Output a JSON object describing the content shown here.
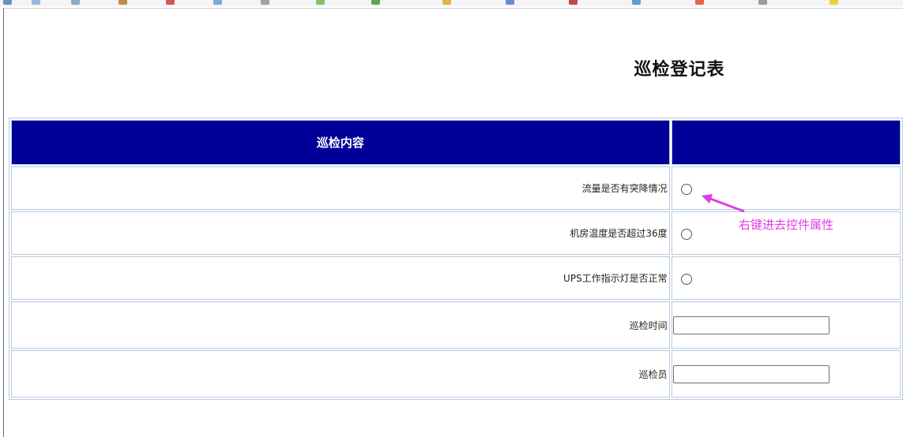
{
  "page": {
    "title": "巡检登记表"
  },
  "table": {
    "header": {
      "col1": "巡检内容",
      "col2": ""
    },
    "rows": [
      {
        "label": "流量是否有突降情况",
        "control": "radio"
      },
      {
        "label": "机房温度是否超过36度",
        "control": "radio"
      },
      {
        "label": "UPS工作指示灯是否正常",
        "control": "radio"
      },
      {
        "label": "巡检时间",
        "control": "text",
        "value": ""
      },
      {
        "label": "巡检员",
        "control": "text",
        "value": ""
      }
    ]
  },
  "annotation": {
    "text": "右键进去控件属性",
    "color": "#e23be8"
  },
  "colors": {
    "header_bg": "#000099",
    "cell_border": "#b7c9dc"
  }
}
